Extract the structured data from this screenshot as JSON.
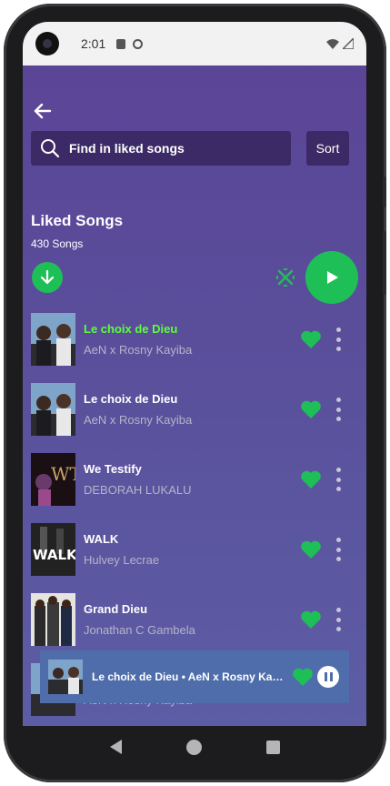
{
  "status": {
    "time": "2:01"
  },
  "header": {
    "search_placeholder": "Find in liked songs",
    "sort_label": "Sort",
    "title": "Liked Songs",
    "count": "430 Songs"
  },
  "songs": [
    {
      "title": "Le choix de Dieu",
      "artist": "AeN x Rosny Kayiba",
      "active": true
    },
    {
      "title": "Le choix de Dieu",
      "artist": "AeN x Rosny Kayiba",
      "active": false
    },
    {
      "title": "We Testify",
      "artist": "DEBORAH LUKALU",
      "active": false
    },
    {
      "title": "WALK",
      "artist": "Hulvey Lecrae",
      "active": false
    },
    {
      "title": "Grand Dieu",
      "artist": "Jonathan C Gambela",
      "active": false
    },
    {
      "title": "",
      "artist": "AeN x Rosny Kayiba",
      "active": false
    }
  ],
  "now_playing": {
    "text": "Le choix de Dieu • AeN x Rosny Kayiba"
  },
  "colors": {
    "accent": "#1fbf57",
    "active_title": "#5bff3a",
    "mini_player": "#4f6daa"
  },
  "icons": [
    "back-arrow-icon",
    "search-icon",
    "download-icon",
    "shuffle-icon",
    "play-icon",
    "heart-icon",
    "more-vertical-icon",
    "pause-icon"
  ]
}
